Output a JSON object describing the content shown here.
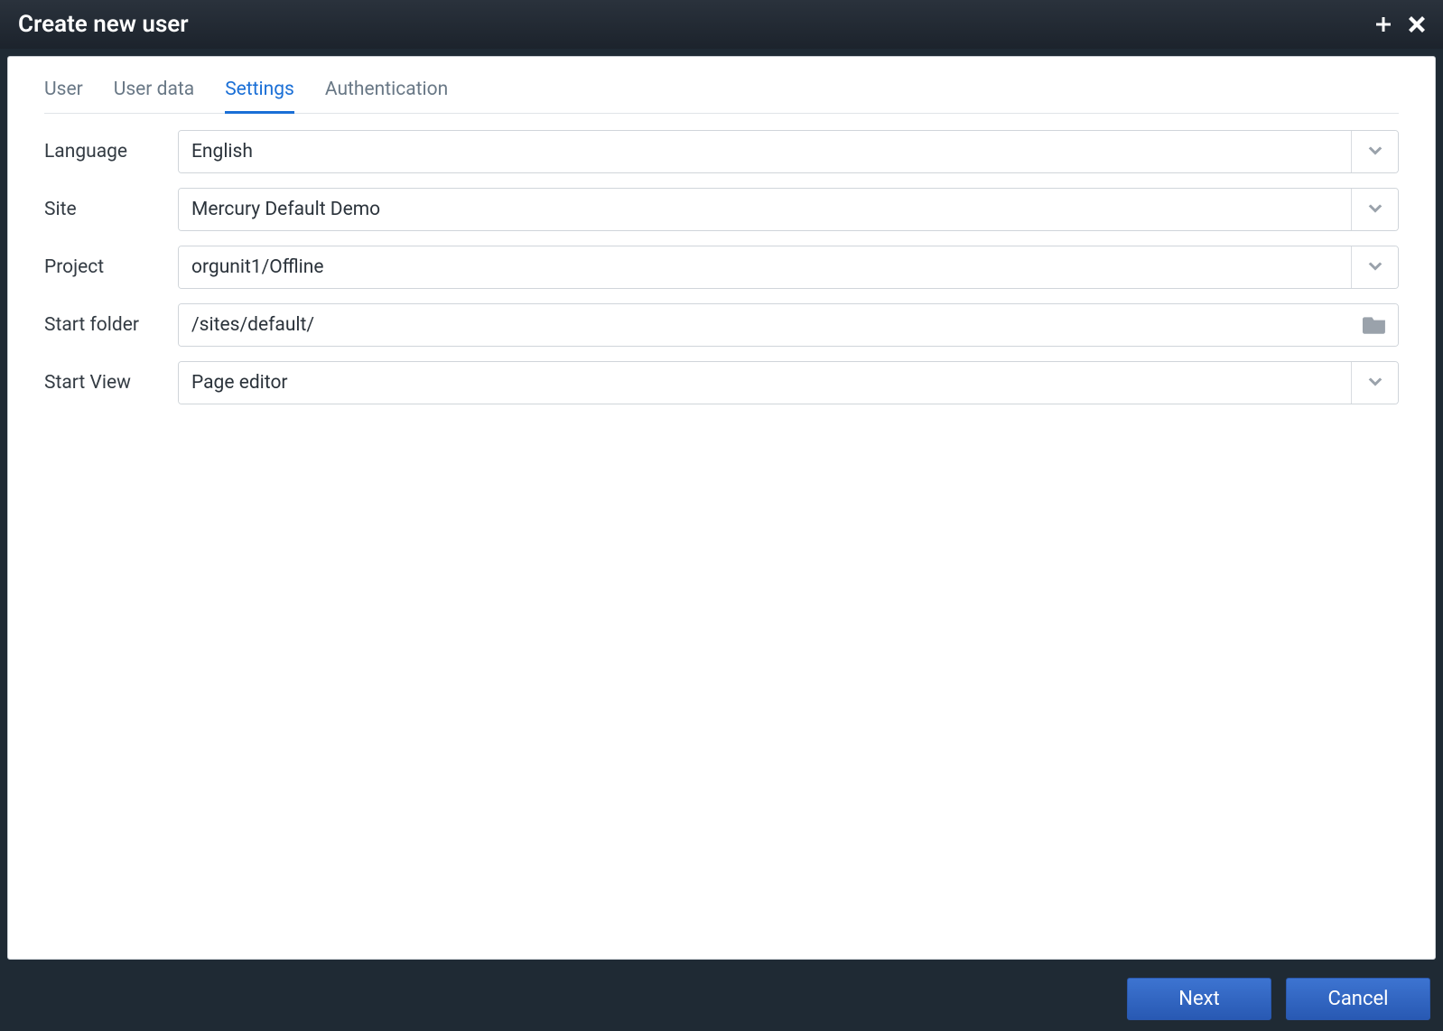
{
  "dialog": {
    "title": "Create new user"
  },
  "tabs": [
    {
      "label": "User",
      "active": false
    },
    {
      "label": "User data",
      "active": false
    },
    {
      "label": "Settings",
      "active": true
    },
    {
      "label": "Authentication",
      "active": false
    }
  ],
  "fields": {
    "language": {
      "label": "Language",
      "value": "English"
    },
    "site": {
      "label": "Site",
      "value": "Mercury Default Demo"
    },
    "project": {
      "label": "Project",
      "value": "orgunit1/Offline"
    },
    "startFolder": {
      "label": "Start folder",
      "value": "/sites/default/"
    },
    "startView": {
      "label": "Start View",
      "value": "Page editor"
    }
  },
  "buttons": {
    "next": "Next",
    "cancel": "Cancel"
  }
}
